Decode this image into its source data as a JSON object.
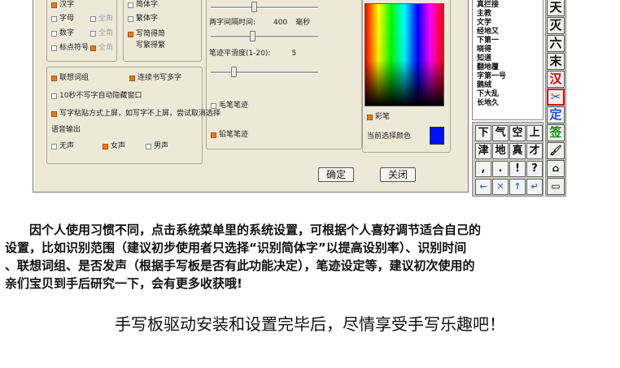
{
  "dialog": {
    "recog_range": [
      {
        "label": "汉字",
        "checked": true
      },
      {
        "label": "字母",
        "checked": false
      },
      {
        "label": "数字",
        "checked": false
      },
      {
        "label": "标点符号",
        "checked": false
      }
    ],
    "full_width": [
      {
        "label": "全角",
        "checked": false
      },
      {
        "label": "全角",
        "checked": false
      },
      {
        "label": "全角",
        "checked": true
      }
    ],
    "char_set": [
      {
        "label": "简体字",
        "checked": false
      },
      {
        "label": "繁体字",
        "checked": false
      },
      {
        "label": "写简得简",
        "checked": true
      },
      {
        "label": "写繁得繁",
        "checked": false
      }
    ],
    "options": [
      {
        "label": "联想词组",
        "checked": true
      },
      {
        "label": "连续书写多字",
        "checked": true
      },
      {
        "label": "10秒不写字自动隐藏窗口",
        "checked": false
      },
      {
        "label": "写字粘贴方式上屏，如写字不上屏，尝试取消选择",
        "checked": true
      }
    ],
    "voice_label": "语音输出",
    "voice": [
      {
        "label": "无声",
        "checked": false
      },
      {
        "label": "女声",
        "checked": true
      },
      {
        "label": "男声",
        "checked": false
      }
    ],
    "interval_label": "两字间隔时间:",
    "interval_value": "400",
    "interval_unit": "毫秒",
    "interval_level": 0.38,
    "smooth_label": "笔迹平滑度(1-20):",
    "smooth_value": "5",
    "smooth_level": 0.2,
    "stroke_level": 0.25,
    "stroke_check": {
      "label": "毛笔笔迹",
      "checked": false
    },
    "pencil_check": {
      "label": "铅笔笔迹",
      "checked": true
    },
    "color_check": {
      "label": "彩笔",
      "checked": true
    },
    "current_color_label": "当前选择颜色",
    "current_color": "#0010ff",
    "ok_label": "确定",
    "close_label": "关闭"
  },
  "candidates": [
    "真拦接",
    "主教",
    "文学",
    "经地又",
    "下第一",
    "晓得",
    "知道",
    "翻地覆",
    "字第一号",
    "鹅绒",
    "下大乱",
    "长地久"
  ],
  "keypad": [
    "下",
    "气",
    "空",
    "上",
    "津",
    "地",
    "真",
    "才",
    ",",
    ".",
    "!",
    "?",
    "←",
    "✕",
    "↑",
    "↵"
  ],
  "sidebar": [
    "天",
    "灭",
    "六",
    "末",
    "汉",
    "✂",
    "定",
    "签",
    "🖌",
    "⌂",
    "▭"
  ],
  "sidebar_colors": [
    "#111",
    "#111",
    "#111",
    "#111",
    "#d40000",
    "#1d4fd8",
    "#1d4fd8",
    "#138a13",
    "#111",
    "#111",
    "#111"
  ],
  "paragraph_lines": [
    "　　因个人使用习惯不同，点击系统菜单里的系统设置，可根据个人喜好调节适合自己的",
    "设置，比如识别范围（建议初步使用者只选择“识别简体字”以提高设别率）、识别时间",
    "、联想词组、是否发声（根据手写板是否有此功能决定），笔迹设定等，建议初次使用的",
    "亲们宝贝到手后研究一下，会有更多收获哦!"
  ],
  "slogan": "手写板驱动安装和设置完毕后，尽情享受手写乐趣吧！"
}
